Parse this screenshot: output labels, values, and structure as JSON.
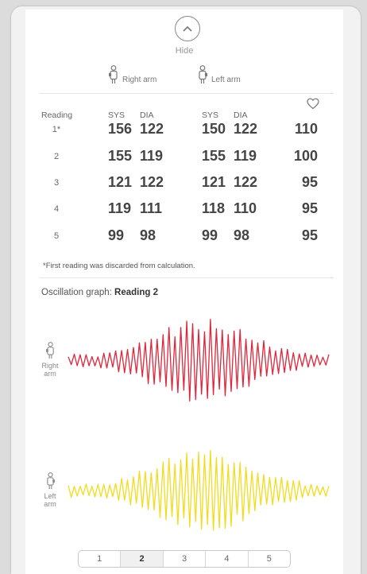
{
  "hide_label": "Hide",
  "arms": {
    "right_label": "Right arm",
    "left_label": "Left arm"
  },
  "table": {
    "col_reading": "Reading",
    "col_sys": "SYS",
    "col_dia": "DIA",
    "pulse_icon": "heart-icon",
    "rows": [
      {
        "label": "1*",
        "r_sys": "156",
        "r_dia": "122",
        "l_sys": "150",
        "l_dia": "122",
        "pulse": "110"
      },
      {
        "label": "2",
        "r_sys": "155",
        "r_dia": "119",
        "l_sys": "155",
        "l_dia": "119",
        "pulse": "100"
      },
      {
        "label": "3",
        "r_sys": "121",
        "r_dia": "122",
        "l_sys": "121",
        "l_dia": "122",
        "pulse": "95"
      },
      {
        "label": "4",
        "r_sys": "119",
        "r_dia": "111",
        "l_sys": "118",
        "l_dia": "110",
        "pulse": "95"
      },
      {
        "label": "5",
        "r_sys": "99",
        "r_dia": "98",
        "l_sys": "99",
        "l_dia": "98",
        "pulse": "95"
      }
    ],
    "footnote": "*First reading was discarded from calculation."
  },
  "oscillation": {
    "title_prefix": "Oscillation graph: ",
    "title_reading": "Reading 2",
    "right_label_line1": "Right",
    "left_label_line1": "Left",
    "label_line2": "arm",
    "right_color": "#e0263a",
    "left_color": "#f2dc1e"
  },
  "pager": {
    "pages": [
      "1",
      "2",
      "3",
      "4",
      "5"
    ],
    "active": "2"
  },
  "colors": {
    "background": "#dcdcdc",
    "card": "#ffffff",
    "text": "#444444"
  }
}
